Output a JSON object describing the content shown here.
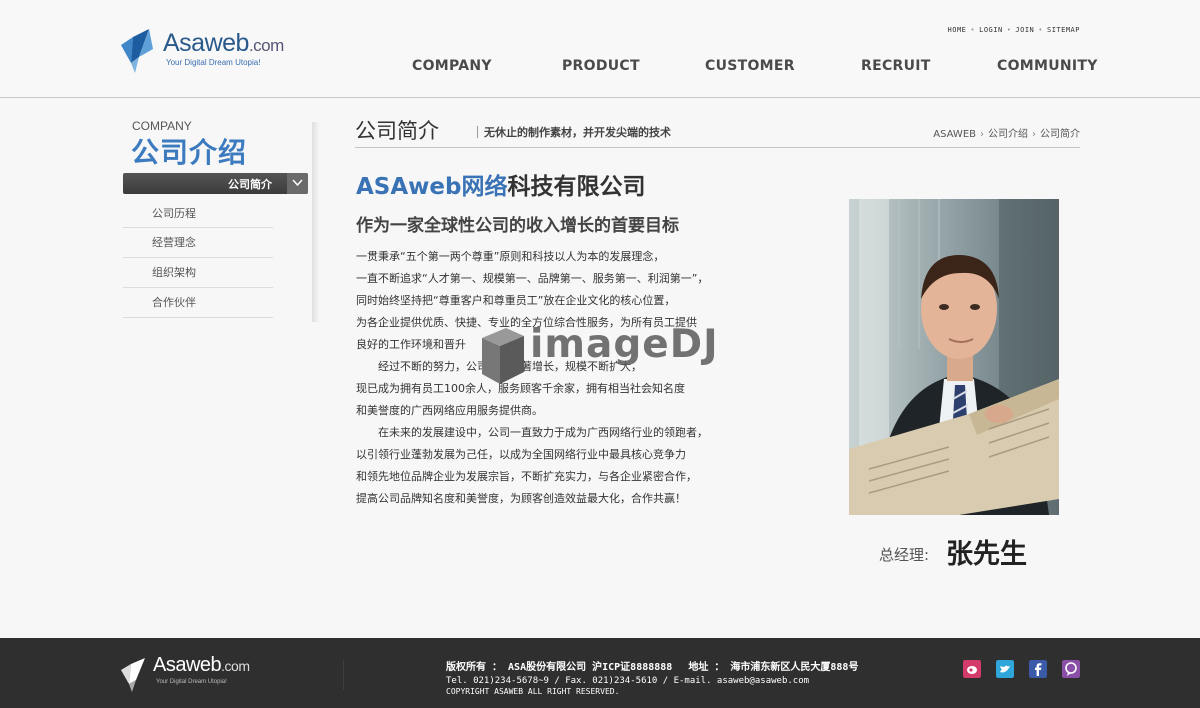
{
  "header": {
    "logo": {
      "brand": "Asaweb",
      "brand_suffix": ".com",
      "tagline": "Your Digital Dream Utopia!"
    },
    "util_links": [
      "HOME",
      "LOGIN",
      "JOIN",
      "SITEMAP"
    ],
    "nav": [
      "COMPANY",
      "PRODUCT",
      "CUSTOMER",
      "RECRUIT",
      "COMMUNITY"
    ]
  },
  "sidebar": {
    "title_en": "COMPANY",
    "title_cn": "公司介绍",
    "active": "公司简介",
    "items": [
      "公司历程",
      "经营理念",
      "组织架构",
      "合作伙伴"
    ]
  },
  "content": {
    "title": "公司简介",
    "subtitle": "无休止的制作素材，并开发尖端的技术",
    "breadcrumb": [
      "ASAWEB",
      "公司介绍",
      "公司简介"
    ],
    "company_highlight": "ASAweb网络",
    "company_rest": "科技有限公司",
    "headline": "作为一家全球性公司的收入增长的首要目标",
    "paragraphs": [
      {
        "indent": false,
        "lines": [
          "一贯秉承“五个第一两个尊重”原则和科技以人为本的发展理念，",
          "一直不断追求“人才第一、规模第一、品牌第一、服务第一、利润第一”，",
          "同时始终坚持把“尊重客户和尊重员工”放在企业文化的核心位置，",
          "为各企业提供优质、快捷、专业的全方位综合性服务，为所有员工提供",
          "良好的工作环境和晋升"
        ]
      },
      {
        "indent": true,
        "lines": [
          "经过不断的努力，公司规模显著增长，规模不断扩大，"
        ]
      },
      {
        "indent": false,
        "lines": [
          "现已成为拥有员工100余人，服务顾客千余家，拥有相当社会知名度",
          "和美誉度的广西网络应用服务提供商。"
        ]
      },
      {
        "indent": true,
        "lines": [
          "在未来的发展建设中，公司一直致力于成为广西网络行业的领跑者，"
        ]
      },
      {
        "indent": false,
        "lines": [
          "以引领行业蓬勃发展为己任，以成为全国网络行业中最具核心竞争力",
          "和领先地位品牌企业为发展宗旨，不断扩充实力，与各企业紧密合作，",
          "提高公司品牌知名度和美誉度，为顾客创造效益最大化，合作共赢！"
        ]
      }
    ],
    "watermark": "imageDJ",
    "manager_label": "总经理:",
    "manager_name": "张先生"
  },
  "footer": {
    "logo": {
      "brand": "Asaweb",
      "brand_suffix": ".com",
      "tagline": "Your Digital Dream Utopia!"
    },
    "line1": "版权所有 ： ASA股份有限公司 沪ICP证8888888　 地址 ： 海市浦东新区人民大厦888号",
    "line2": "Tel. 021)234-5678~9  / Fax. 021)234-5610  / E-mail. asaweb@asaweb.com",
    "line3": "COPYRIGHT ASAWEB ALL RIGHT RESERVED.",
    "social_icons": [
      "weibo-icon",
      "twitter-icon",
      "facebook-icon",
      "chat-icon"
    ]
  },
  "colors": {
    "accent_blue": "#3a73b5",
    "footer_bg": "#2f2f2f",
    "dark_button": "#3b3b3b"
  }
}
